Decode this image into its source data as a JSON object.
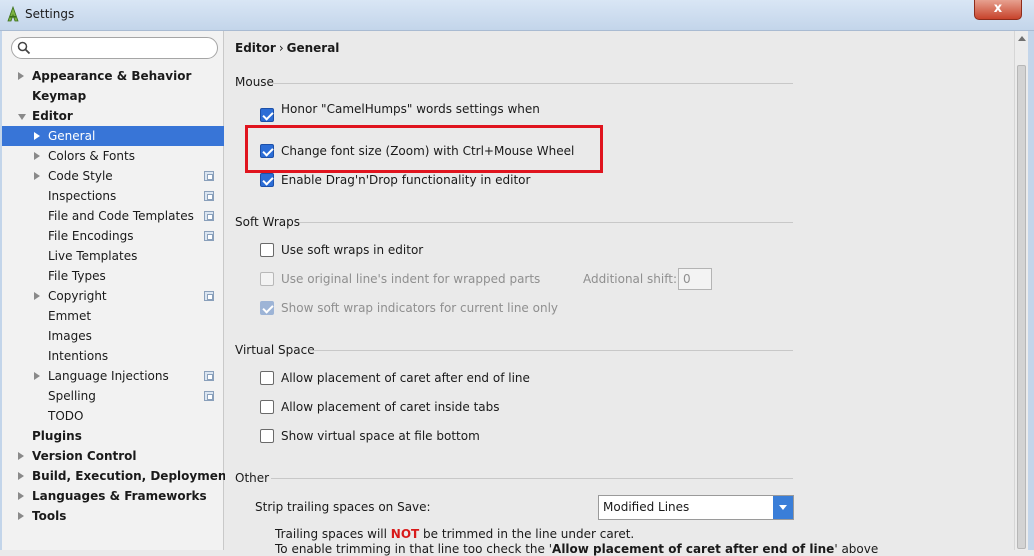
{
  "window": {
    "title": "Settings",
    "close_label": "x"
  },
  "search": {
    "placeholder": "",
    "value": ""
  },
  "sidebar": {
    "items": [
      {
        "label": "Appearance & Behavior",
        "level": 0,
        "arrow": "right",
        "bold": true
      },
      {
        "label": "Keymap",
        "level": 0,
        "arrow": "none",
        "bold": true
      },
      {
        "label": "Editor",
        "level": 0,
        "arrow": "down",
        "bold": true
      },
      {
        "label": "General",
        "level": 1,
        "arrow": "right",
        "selected": true
      },
      {
        "label": "Colors & Fonts",
        "level": 1,
        "arrow": "right"
      },
      {
        "label": "Code Style",
        "level": 1,
        "arrow": "right",
        "project_icon": true
      },
      {
        "label": "Inspections",
        "level": 1,
        "arrow": "none",
        "project_icon": true
      },
      {
        "label": "File and Code Templates",
        "level": 1,
        "arrow": "none",
        "project_icon": true
      },
      {
        "label": "File Encodings",
        "level": 1,
        "arrow": "none",
        "project_icon": true
      },
      {
        "label": "Live Templates",
        "level": 1,
        "arrow": "none"
      },
      {
        "label": "File Types",
        "level": 1,
        "arrow": "none"
      },
      {
        "label": "Copyright",
        "level": 1,
        "arrow": "right",
        "project_icon": true
      },
      {
        "label": "Emmet",
        "level": 1,
        "arrow": "none"
      },
      {
        "label": "Images",
        "level": 1,
        "arrow": "none"
      },
      {
        "label": "Intentions",
        "level": 1,
        "arrow": "none"
      },
      {
        "label": "Language Injections",
        "level": 1,
        "arrow": "right",
        "project_icon": true
      },
      {
        "label": "Spelling",
        "level": 1,
        "arrow": "none",
        "project_icon": true
      },
      {
        "label": "TODO",
        "level": 1,
        "arrow": "none"
      },
      {
        "label": "Plugins",
        "level": 0,
        "arrow": "none",
        "bold": true
      },
      {
        "label": "Version Control",
        "level": 0,
        "arrow": "right",
        "bold": true
      },
      {
        "label": "Build, Execution, Deployment",
        "level": 0,
        "arrow": "right",
        "bold": true
      },
      {
        "label": "Languages & Frameworks",
        "level": 0,
        "arrow": "right",
        "bold": true
      },
      {
        "label": "Tools",
        "level": 0,
        "arrow": "right",
        "bold": true
      }
    ]
  },
  "breadcrumb": {
    "parent": "Editor",
    "separator": "›",
    "current": "General"
  },
  "mouse": {
    "title": "Mouse",
    "camelhumps": {
      "label": "Honor \"CamelHumps\" words settings when selecting on double click",
      "checked": true
    },
    "zoom": {
      "label": "Change font size (Zoom) with Ctrl+Mouse Wheel",
      "checked": true
    },
    "dragdrop": {
      "label": "Enable Drag'n'Drop functionality in editor",
      "checked": true
    }
  },
  "soft_wraps": {
    "title": "Soft Wraps",
    "use_soft_wraps": {
      "label": "Use soft wraps in editor",
      "checked": false
    },
    "original_indent": {
      "label": "Use original line's indent for wrapped parts",
      "checked": false,
      "disabled": true
    },
    "additional_shift_label": "Additional shift:",
    "additional_shift_value": "0",
    "show_indicators": {
      "label": "Show soft wrap indicators for current line only",
      "checked": true,
      "disabled": true
    }
  },
  "virtual_space": {
    "title": "Virtual Space",
    "after_end": {
      "label": "Allow placement of caret after end of line",
      "checked": false
    },
    "inside_tabs": {
      "label": "Allow placement of caret inside tabs",
      "checked": false
    },
    "file_bottom": {
      "label": "Show virtual space at file bottom",
      "checked": false
    }
  },
  "other": {
    "title": "Other",
    "strip_label": "Strip trailing spaces on Save:",
    "strip_value": "Modified Lines",
    "note1_a": "Trailing spaces will ",
    "note1_not": "NOT",
    "note1_b": " be trimmed in the line under caret.",
    "note2_a": "To enable trimming in that line too check the '",
    "note2_bold": "Allow placement of caret after end of line",
    "note2_b": "' above"
  },
  "colors": {
    "selection": "#3875d7",
    "highlight": "#e0141e",
    "checkbox": "#2c6dd6"
  }
}
